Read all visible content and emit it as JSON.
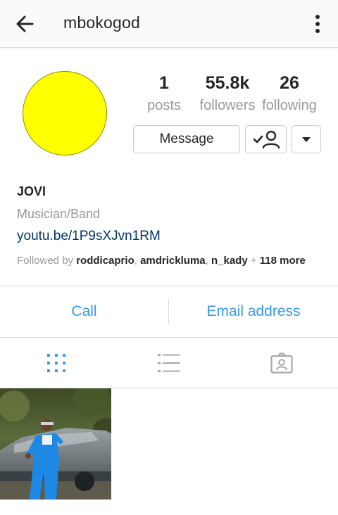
{
  "header": {
    "username": "mbokogod"
  },
  "profile": {
    "stats": [
      {
        "value": "1",
        "label": "posts"
      },
      {
        "value": "55.8k",
        "label": "followers"
      },
      {
        "value": "26",
        "label": "following"
      }
    ],
    "message_label": "Message",
    "name": "JOVI",
    "category": "Musician/Band",
    "link": "youtu.be/1P9sXJvn1RM",
    "followed_by": {
      "prefix": "Followed by",
      "users": [
        "roddicaprio",
        "amdrickluma",
        "n_kady"
      ],
      "plus": "+",
      "more": "118 more"
    }
  },
  "contact": {
    "call_label": "Call",
    "email_label": "Email address"
  },
  "tabs": [
    {
      "icon": "grid-icon",
      "active": true
    },
    {
      "icon": "list-icon",
      "active": false
    },
    {
      "icon": "tagged-icon",
      "active": false
    }
  ],
  "colors": {
    "accent": "#3897f0",
    "link": "#003569",
    "avatar": "#ffff00",
    "muted": "#999999"
  }
}
